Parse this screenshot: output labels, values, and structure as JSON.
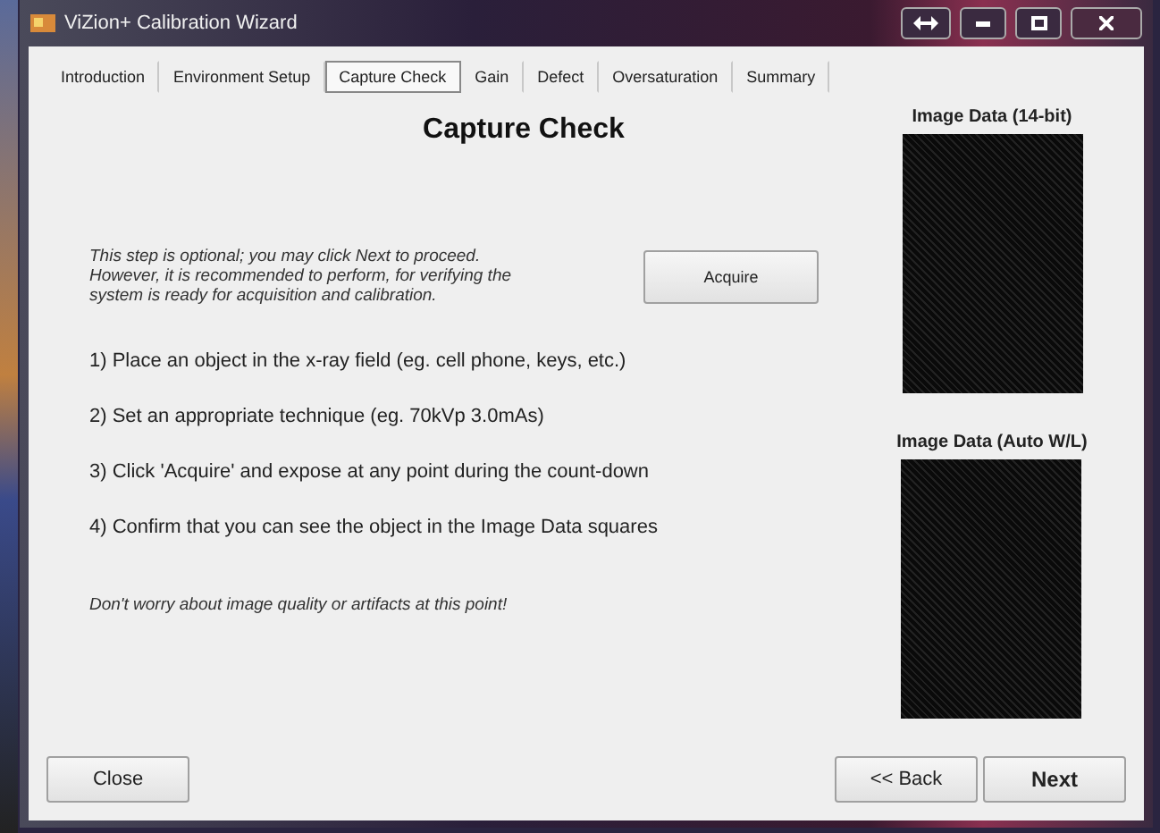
{
  "window": {
    "title": "ViZion+ Calibration Wizard"
  },
  "tabs": [
    {
      "label": "Introduction",
      "selected": false
    },
    {
      "label": "Environment Setup",
      "selected": false
    },
    {
      "label": "Capture Check",
      "selected": true
    },
    {
      "label": "Gain",
      "selected": false
    },
    {
      "label": "Defect",
      "selected": false
    },
    {
      "label": "Oversaturation",
      "selected": false
    },
    {
      "label": "Summary",
      "selected": false
    }
  ],
  "heading": "Capture Check",
  "intro": "This step is optional;  you may click Next to proceed. However, it is recommended to perform, for verifying the system is ready for acquisition and calibration.",
  "acquire_button": "Acquire",
  "steps": [
    "1)  Place an object in the x-ray field  (eg. cell phone, keys, etc.)",
    "2)  Set an appropriate technique  (eg.  70kVp  3.0mAs)",
    "3)  Click 'Acquire'  and expose at any point during the count-down",
    "4)  Confirm that you can see the object in the Image Data squares"
  ],
  "note": "Don't worry about image quality or artifacts at this point!",
  "image_panels": [
    {
      "label": "Image Data (14-bit)"
    },
    {
      "label": "Image Data (Auto W/L)"
    }
  ],
  "buttons": {
    "close": "Close",
    "back": "<< Back",
    "next": "Next"
  }
}
